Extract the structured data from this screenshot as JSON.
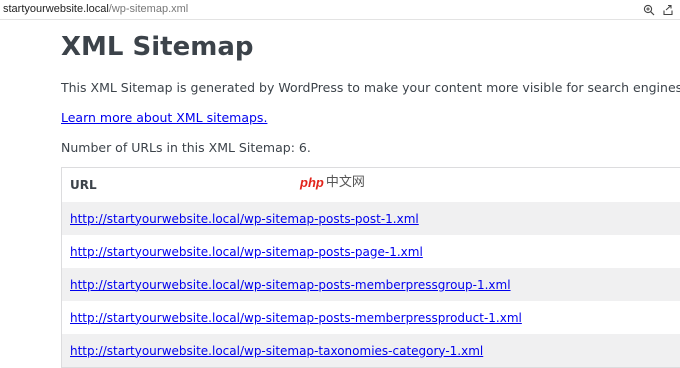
{
  "browser": {
    "url_host": "startyourwebsite.local",
    "url_path": "/wp-sitemap.xml",
    "zoom_icon": "zoom-in-icon",
    "share_icon": "share-icon"
  },
  "page": {
    "title": "XML Sitemap",
    "description": "This XML Sitemap is generated by WordPress to make your content more visible for search engines.",
    "learn_more_link": "Learn more about XML sitemaps.",
    "url_count_text": "Number of URLs in this XML Sitemap: 6."
  },
  "table": {
    "header": "URL",
    "rows": [
      "http://startyourwebsite.local/wp-sitemap-posts-post-1.xml",
      "http://startyourwebsite.local/wp-sitemap-posts-page-1.xml",
      "http://startyourwebsite.local/wp-sitemap-posts-memberpressgroup-1.xml",
      "http://startyourwebsite.local/wp-sitemap-posts-memberpressproduct-1.xml",
      "http://startyourwebsite.local/wp-sitemap-taxonomies-category-1.xml"
    ]
  },
  "watermark": {
    "brand": "php",
    "text": "中文网",
    "brand_color": "#e2231a"
  },
  "colors": {
    "link": "#0000ee",
    "text": "#3c434a",
    "row_shade": "#f0f0f1"
  }
}
